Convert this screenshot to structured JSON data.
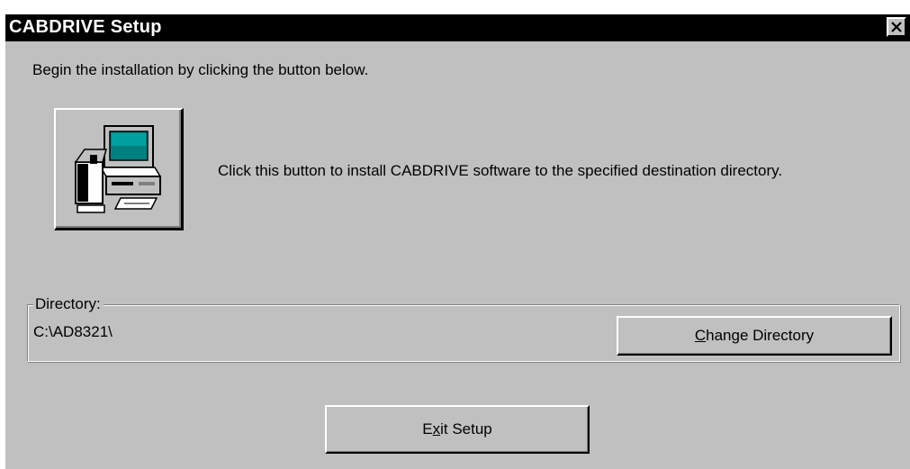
{
  "window": {
    "title": "CABDRIVE Setup"
  },
  "intro": {
    "text": "Begin the installation by clicking the button below."
  },
  "install": {
    "icon": "computer-setup-icon",
    "description": "Click this button to install CABDRIVE software to the specified destination directory."
  },
  "directory": {
    "label": "Directory:",
    "path": "C:\\AD8321\\",
    "change_button": {
      "accel": "C",
      "rest": "hange Directory"
    }
  },
  "exit_button": {
    "before": "E",
    "accel": "x",
    "after": "it Setup"
  },
  "colors": {
    "face": "#c0c0c0",
    "titlebar": "#000000",
    "title_text": "#ffffff"
  }
}
